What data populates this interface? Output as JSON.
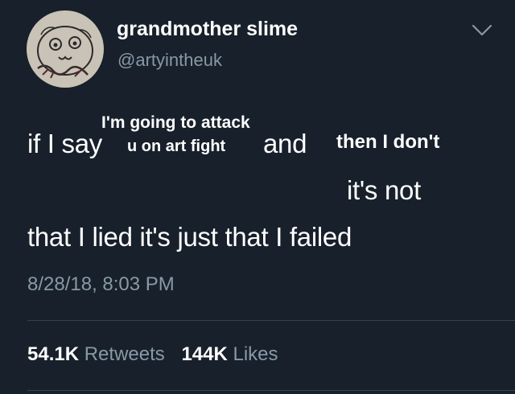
{
  "user": {
    "display_name": "grandmother slime",
    "handle": "@artyintheuk"
  },
  "icons": {
    "avatar": "avatar-sketch",
    "menu": "chevron-down-icon"
  },
  "tweet": {
    "if_i_say": "if I say",
    "overlay_top": "I'm going to attack",
    "overlay_bottom": "u on art fight",
    "and": "and",
    "overlay_then": "then I don't",
    "its_not": "it's not",
    "line_last": "that I lied it's just that I failed"
  },
  "timestamp": "8/28/18, 8:03 PM",
  "stats": {
    "retweets_count": "54.1K",
    "retweets_label": "Retweets",
    "likes_count": "144K",
    "likes_label": "Likes"
  },
  "colors": {
    "background": "#17202b",
    "text": "#ffffff",
    "secondary": "#8899a6",
    "divider": "#38444d"
  }
}
